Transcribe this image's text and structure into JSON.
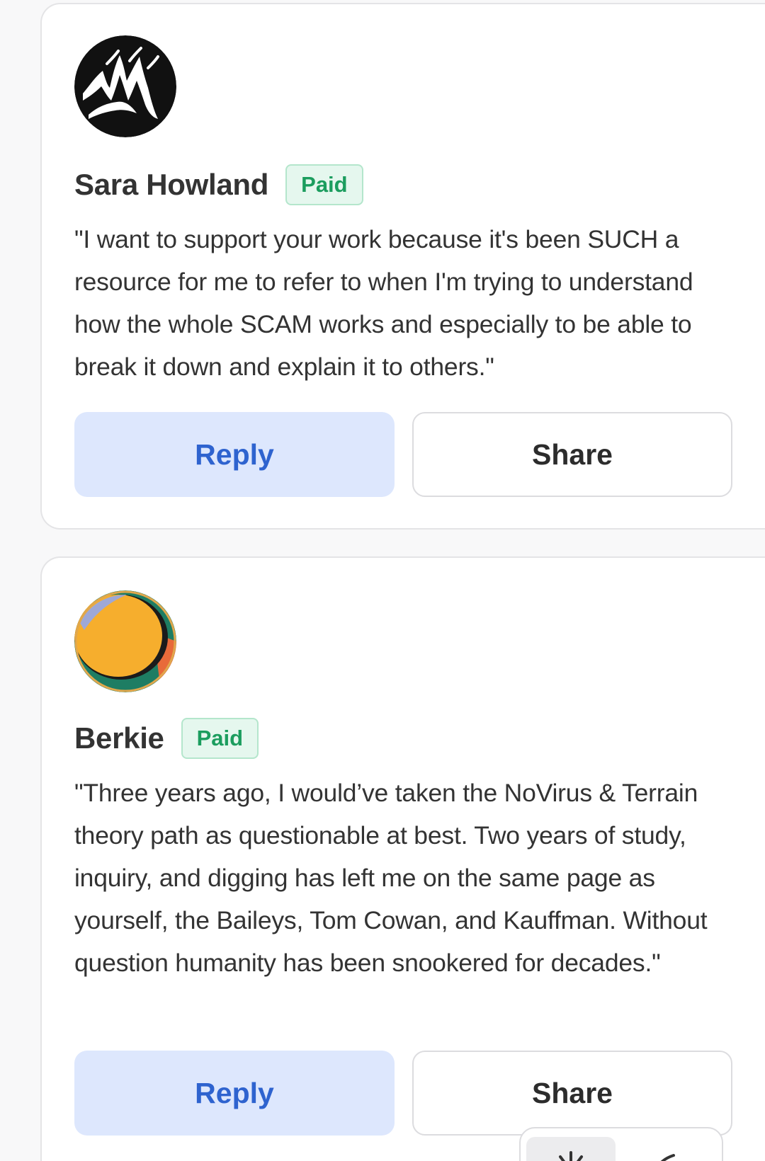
{
  "comments": [
    {
      "name": "Sara Howland",
      "badge": "Paid",
      "avatar_icon": "black-mountain-brush-logo-icon",
      "text": "\"I want to support your work because it's been SUCH a resource for me to refer to when I'm trying to understand how the whole SCAM works and especially to be able to break it down and explain it to others.\"",
      "reply_label": "Reply",
      "share_label": "Share"
    },
    {
      "name": "Berkie",
      "badge": "Paid",
      "avatar_icon": "orange-circle-abstract-icon",
      "text": "\"Three years ago, I would’ve taken the NoVirus & Terrain theory path as questionable at best. Two years of study, inquiry, and digging has left me on the same page as yourself, the Baileys, Tom Cowan, and Kauffman. Without question humanity has been snookered for decades.\"",
      "reply_label": "Reply",
      "share_label": "Share"
    }
  ],
  "colors": {
    "paid_badge_text": "#1b9d5e",
    "paid_badge_bg": "#e5f7ee",
    "reply_bg": "#dde7fd",
    "reply_text": "#2e63cf"
  }
}
